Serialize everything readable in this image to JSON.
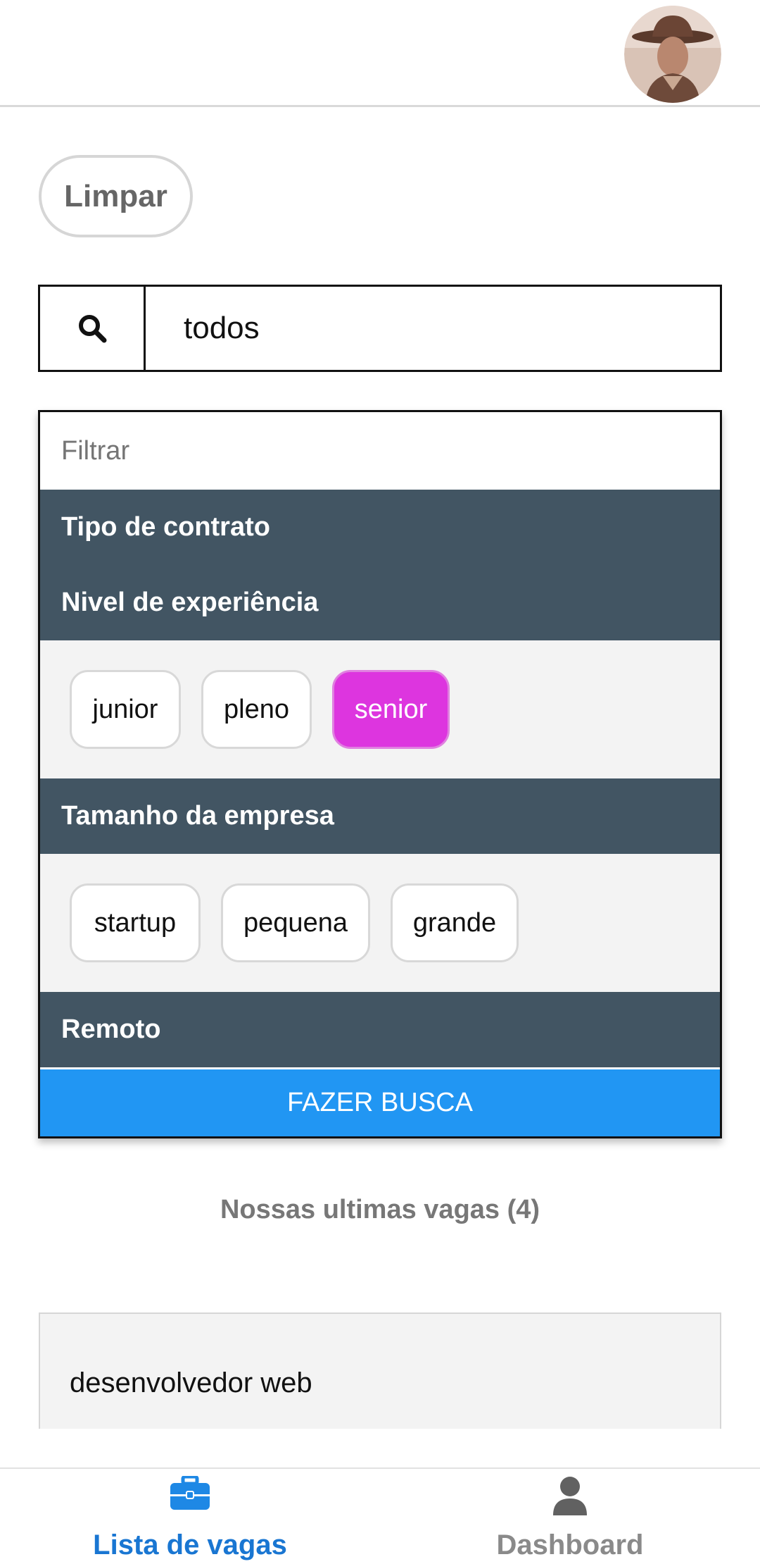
{
  "header": {
    "avatar_icon": "user-avatar-photo"
  },
  "clear_button": {
    "label": "Limpar"
  },
  "search": {
    "icon": "search-icon",
    "value": "todos"
  },
  "filters": {
    "placeholder": "Filtrar",
    "sections": [
      {
        "title": "Tipo de contrato",
        "options": []
      },
      {
        "title": "Nivel de experiência",
        "options": [
          "junior",
          "pleno",
          "senior"
        ],
        "selected": "senior"
      },
      {
        "title": "Tamanho da empresa",
        "options": [
          "startup",
          "pequena",
          "grande"
        ],
        "selected": null
      },
      {
        "title": "Remoto",
        "options": []
      }
    ],
    "submit_label": "FAZER BUSCA"
  },
  "latest": {
    "title": "Nossas ultimas vagas (4)"
  },
  "jobs": [
    {
      "title": "desenvolvedor web"
    }
  ],
  "bottom_nav": {
    "items": [
      {
        "label": "Lista de vagas",
        "icon": "briefcase-icon",
        "active": true
      },
      {
        "label": "Dashboard",
        "icon": "person-icon",
        "active": false
      }
    ]
  },
  "colors": {
    "accent_blue": "#2196f3",
    "nav_active": "#1976d2",
    "section_header": "#425563",
    "selected_chip": "#dd35df"
  }
}
